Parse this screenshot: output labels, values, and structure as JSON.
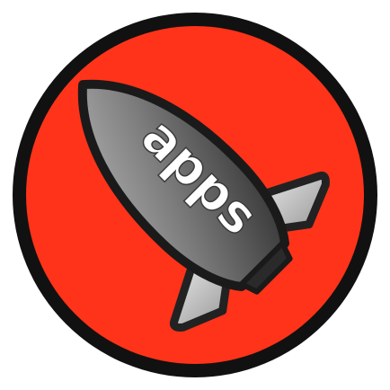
{
  "icon": {
    "label": "apps",
    "name": "rocket-icon",
    "colors": {
      "background": "#ff3319",
      "ring": "#111111",
      "rocket_body_light": "#9a9a9a",
      "rocket_body_dark": "#3a3a3a",
      "fin": "#c8c8c8",
      "outline": "#222222",
      "label_text": "#ffffff"
    }
  }
}
